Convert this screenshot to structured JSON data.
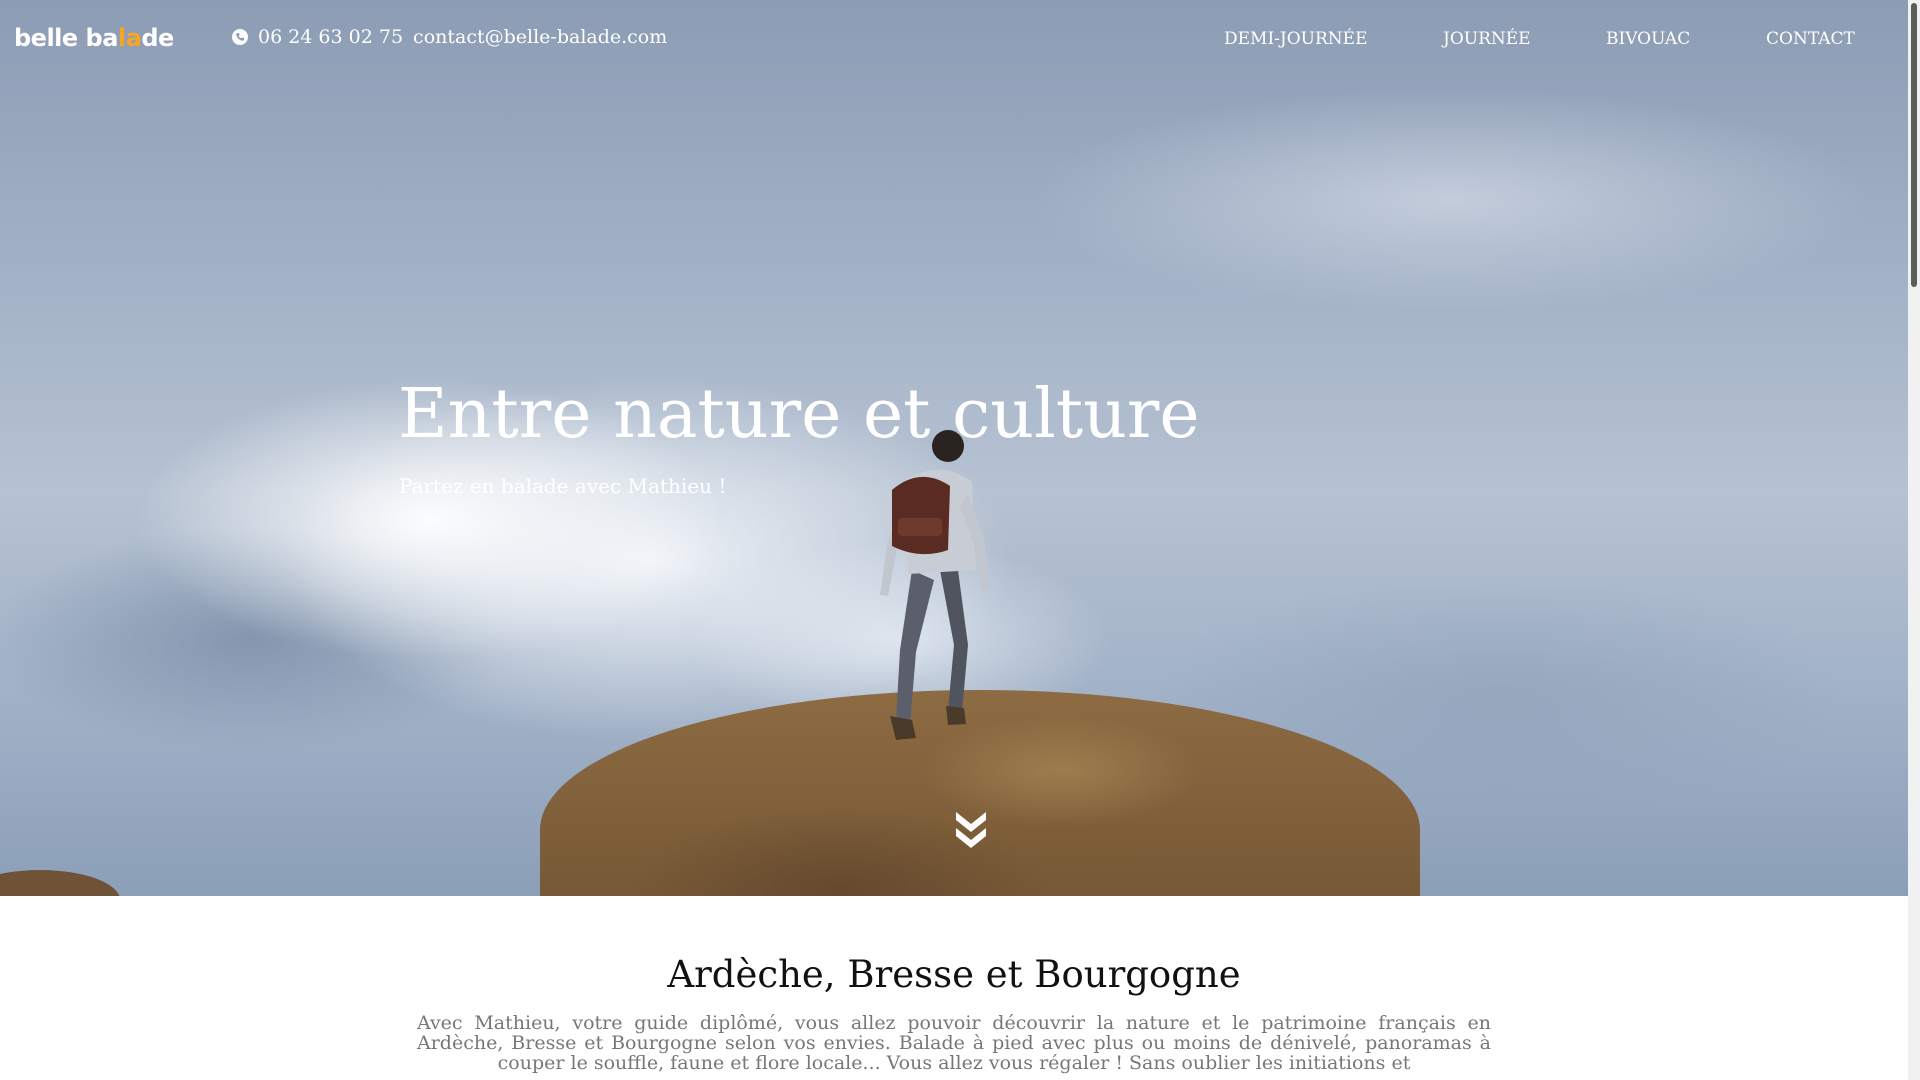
{
  "header": {
    "logo_parts": [
      "belle ba",
      "la",
      "de"
    ],
    "phone": "06 24 63 02 75",
    "email": "contact@belle-balade.com",
    "nav": [
      {
        "label": "DEMI-JOURNÉE"
      },
      {
        "label": "JOURNÉE"
      },
      {
        "label": "BIVOUAC"
      },
      {
        "label": "CONTACT"
      }
    ]
  },
  "hero": {
    "title": "Entre nature et culture",
    "subtitle": "Partez en balade avec Mathieu !",
    "scroll_icon": "double-chevron-down-icon"
  },
  "intro": {
    "title": "Ardèche, Bresse et Bourgogne",
    "text": "Avec Mathieu, votre guide diplômé, vous allez pouvoir découvrir la nature et le patrimoine français en Ardèche, Bresse et Bourgogne selon vos envies. Balade à pied avec plus ou moins de dénivelé, panoramas à couper le souffle, faune et flore locale... Vous allez vous régaler ! Sans oublier les initiations et"
  },
  "colors": {
    "logo_accent": "#f5a623",
    "text_muted": "#777777"
  }
}
